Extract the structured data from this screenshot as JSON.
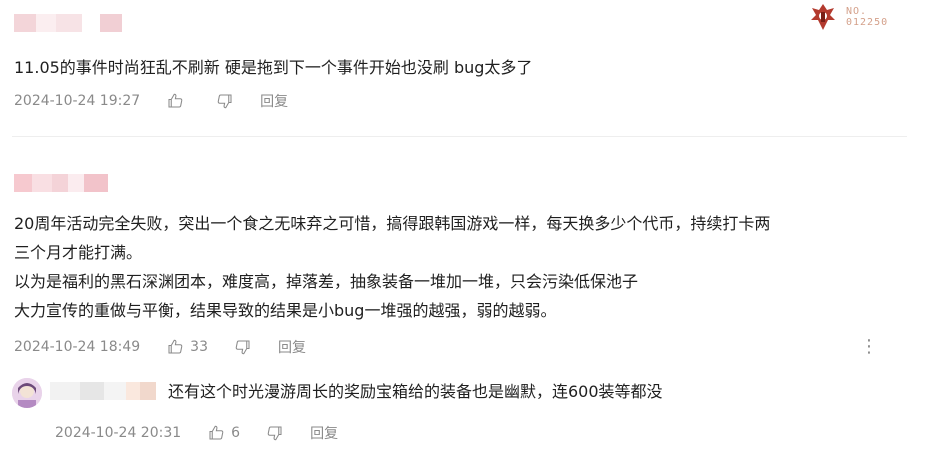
{
  "comments": [
    {
      "text_lines": [
        "11.05的事件时尚狂乱不刷新 硬是拖到下一个事件开始也没刷 bug太多了"
      ],
      "time": "2024-10-24 19:27",
      "like_count": "",
      "reply_label": "回复"
    },
    {
      "text_lines": [
        "20周年活动完全失败，突出一个食之无味弃之可惜，搞得跟韩国游戏一样，每天换多少个代币，持续打卡两",
        "三个月才能打满。",
        "以为是福利的黑石深渊团本，难度高，掉落差，抽象装备一堆加一堆，只会污染低保池子",
        "大力宣传的重做与平衡，结果导致的结果是小bug一堆强的越强，弱的越弱。"
      ],
      "time": "2024-10-24 18:49",
      "like_count": "33",
      "reply_label": "回复",
      "more_label": "⋮"
    }
  ],
  "reply": {
    "text": "还有这个时光漫游周长的奖励宝箱给的装备也是幽默，连600装等都没",
    "time": "2024-10-24 20:31",
    "like_count": "6",
    "reply_label": "回复"
  },
  "badge": {
    "no_label": "NO.",
    "number": "012250"
  },
  "colors": {
    "text": "#1f1f1f",
    "meta": "#8a8a8a",
    "badge_accent": "#d4a08a",
    "mosaic_pink": "#f6c9cf"
  },
  "icons": {
    "like": "thumbs-up-icon",
    "dislike": "thumbs-down-icon",
    "more": "more-vertical-icon",
    "badge": "horde-emblem-icon"
  }
}
